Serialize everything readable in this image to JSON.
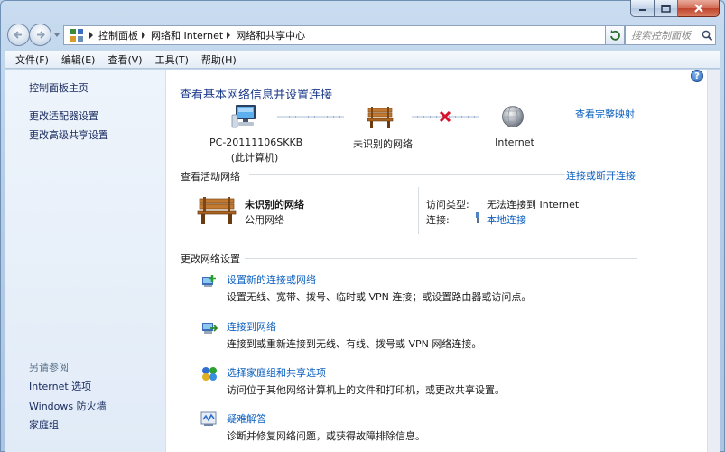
{
  "window": {
    "address_crumbs": [
      "控制面板",
      "网络和 Internet",
      "网络和共享中心"
    ],
    "search_placeholder": "搜索控制面板"
  },
  "menu": [
    "文件(F)",
    "编辑(E)",
    "查看(V)",
    "工具(T)",
    "帮助(H)"
  ],
  "sidebar": {
    "top_links": [
      "控制面板主页",
      "更改适配器设置",
      "更改高级共享设置"
    ],
    "see_also_title": "另请参阅",
    "see_also_links": [
      "Internet 选项",
      "Windows 防火墙",
      "家庭组"
    ]
  },
  "main": {
    "title": "查看基本网络信息并设置连接",
    "view_full_map": "查看完整映射",
    "network_map": {
      "computer_name": "PC-20111106SKKB",
      "computer_sub": "(此计算机)",
      "network_name": "未识别的网络",
      "internet_label": "Internet"
    },
    "active_networks": {
      "heading": "查看活动网络",
      "connect_disconnect": "连接或断开连接",
      "network_title": "未识别的网络",
      "network_type": "公用网络",
      "access_type_label": "访问类型:",
      "access_type_value": "无法连接到 Internet",
      "connection_label": "连接:",
      "connection_value": "本地连接"
    },
    "change_settings": {
      "heading": "更改网络设置",
      "items": [
        {
          "icon": "new-connection-icon",
          "title": "设置新的连接或网络",
          "desc": "设置无线、宽带、拨号、临时或 VPN 连接；或设置路由器或访问点。"
        },
        {
          "icon": "connect-network-icon",
          "title": "连接到网络",
          "desc": "连接到或重新连接到无线、有线、拨号或 VPN 网络连接。"
        },
        {
          "icon": "homegroup-icon",
          "title": "选择家庭组和共享选项",
          "desc": "访问位于其他网络计算机上的文件和打印机，或更改共享设置。"
        },
        {
          "icon": "troubleshoot-icon",
          "title": "疑难解答",
          "desc": "诊断并修复网络问题，或获得故障排除信息。"
        }
      ]
    }
  },
  "colors": {
    "link": "#0b5fbf",
    "title": "#1e3c8c",
    "error": "#d8102a"
  }
}
